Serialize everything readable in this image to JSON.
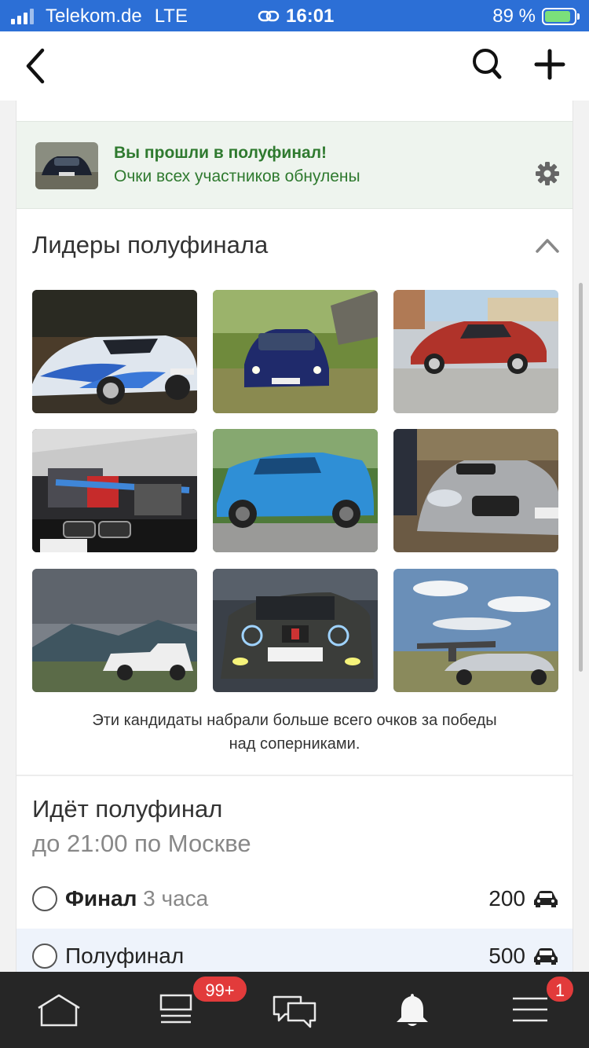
{
  "status_bar": {
    "carrier": "Telekom.de",
    "network": "LTE",
    "time": "16:01",
    "battery_percent": "89 %",
    "battery_level": 0.89
  },
  "nav": {
    "back_icon": "chevron-left-icon",
    "search_icon": "search-icon",
    "add_icon": "plus-icon"
  },
  "notice": {
    "title": "Вы прошли в полуфинал!",
    "subtitle": "Очки всех участников обнулены",
    "accent_color": "#2f7a2f"
  },
  "leaders": {
    "title": "Лидеры полуфинала",
    "caption_line1": "Эти кандидаты набрали больше всего очков за победы",
    "caption_line2": "над соперниками."
  },
  "semifinal": {
    "title": "Идёт полуфинал",
    "subtitle": "до 21:00 по Москве",
    "options": [
      {
        "name": "Финал",
        "extra": "3 часа",
        "price": "200"
      },
      {
        "name": "Полуфинал",
        "extra": "",
        "price": "500"
      }
    ]
  },
  "tabbar": {
    "feed_badge": "99+",
    "notifications_badge": "1"
  }
}
